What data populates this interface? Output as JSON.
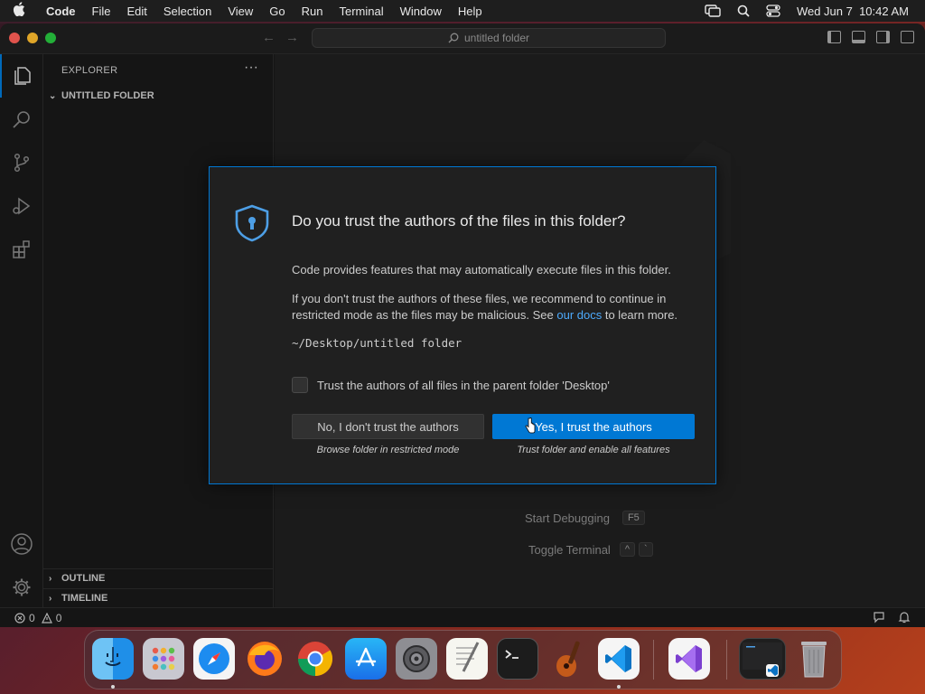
{
  "menubar": {
    "app_name": "Code",
    "items": [
      "File",
      "Edit",
      "Selection",
      "View",
      "Go",
      "Run",
      "Terminal",
      "Window",
      "Help"
    ],
    "clock": "Wed Jun 7  10:42 AM"
  },
  "titlebar": {
    "search_text": "untitled folder"
  },
  "sidebar": {
    "header": "EXPLORER",
    "folder": "UNTITLED FOLDER",
    "outline": "OUTLINE",
    "timeline": "TIMELINE"
  },
  "editor": {
    "hints": [
      {
        "label": "Start Debugging",
        "keys": [
          "F5"
        ]
      },
      {
        "label": "Toggle Terminal",
        "keys": [
          "^",
          "`"
        ]
      }
    ]
  },
  "statusbar": {
    "errors": "0",
    "warnings": "0"
  },
  "dialog": {
    "title": "Do you trust the authors of the files in this folder?",
    "paragraph1": "Code provides features that may automatically execute files in this folder.",
    "paragraph2_before": "If you don't trust the authors of these files, we recommend to continue in restricted mode as the files may be malicious. See ",
    "paragraph2_link": "our docs",
    "paragraph2_after": " to learn more.",
    "path": "~/Desktop/untitled folder",
    "checkbox_label": "Trust the authors of all files in the parent folder 'Desktop'",
    "checkbox_checked": false,
    "no_button": "No, I don't trust the authors",
    "no_subtext": "Browse folder in restricted mode",
    "yes_button": "Yes, I trust the authors",
    "yes_subtext": "Trust folder and enable all features"
  },
  "dock": {
    "apps": [
      "finder",
      "launchpad",
      "safari",
      "firefox",
      "chrome",
      "app-store",
      "system-settings",
      "textedit",
      "terminal",
      "garageband",
      "vscode",
      "visual-studio",
      "vscode-window",
      "trash"
    ]
  },
  "colors": {
    "accent": "#0078d4",
    "link": "#4daafc",
    "dialog_bg": "#202020",
    "editor_bg": "#1f1f1f"
  }
}
